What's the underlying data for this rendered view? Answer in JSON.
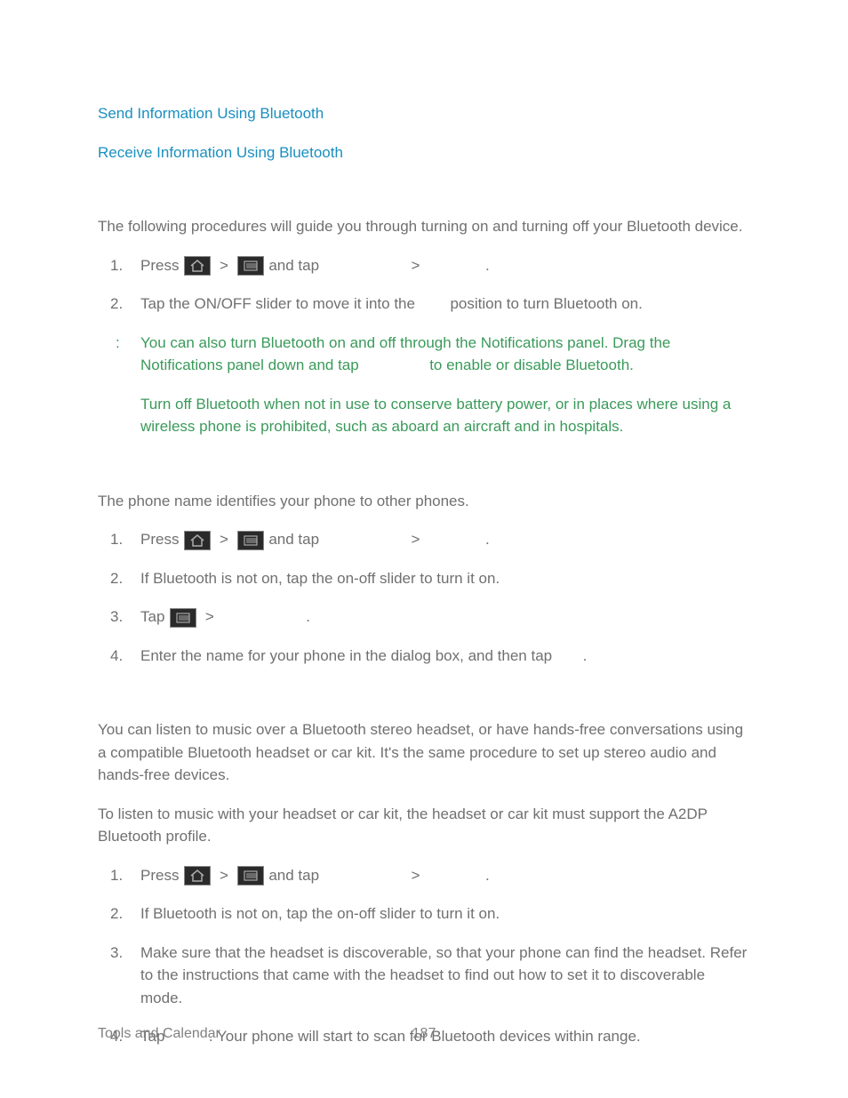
{
  "links": {
    "send": "Send Information Using Bluetooth",
    "receive": "Receive Information Using Bluetooth"
  },
  "section1": {
    "intro": "The following procedures will guide you through turning on and turning off your Bluetooth device.",
    "step1_a": "Press",
    "step1_b": "and tap",
    "step1_c": ".",
    "step2_a": "Tap the ON/OFF slider to move it into the",
    "step2_b": "position to turn Bluetooth on.",
    "note1_a": "You can also turn Bluetooth on and off through the Notifications panel. Drag the Notifications panel down and tap",
    "note1_b": "to enable or disable Bluetooth.",
    "note2": "Turn off Bluetooth when not in use to conserve battery power, or in places where using a wireless phone is prohibited, such as aboard an aircraft and in hospitals."
  },
  "section2": {
    "intro": "The phone name identifies your phone to other phones.",
    "step1_a": "Press",
    "step1_b": "and tap",
    "step1_c": ".",
    "step2": "If Bluetooth is not on, tap the on-off slider to turn it on.",
    "step3_a": "Tap",
    "step3_b": ".",
    "step4_a": "Enter the name for your phone in the dialog box, and then tap",
    "step4_b": "."
  },
  "section3": {
    "intro1": "You can listen to music over a Bluetooth stereo headset, or have hands-free conversations using a compatible Bluetooth headset or car kit. It's the same procedure to set up stereo audio and hands-free devices.",
    "intro2": "To listen to music with your headset or car kit, the headset or car kit must support the A2DP Bluetooth profile.",
    "step1_a": "Press",
    "step1_b": "and tap",
    "step1_c": ".",
    "step2": "If Bluetooth is not on, tap the on-off slider to turn it on.",
    "step3": "Make sure that the headset is discoverable, so that your phone can find the headset. Refer to the instructions that came with the headset to find out how to set it to discoverable mode.",
    "step4_a": "Tap",
    "step4_b": ". Your phone will start to scan for Bluetooth devices within range."
  },
  "nums": {
    "n1": "1.",
    "n2": "2.",
    "n3": "3.",
    "n4": "4."
  },
  "sym": {
    "gt": ">",
    "colon": ":"
  },
  "footer": {
    "section": "Tools and Calendar",
    "page": "187"
  }
}
